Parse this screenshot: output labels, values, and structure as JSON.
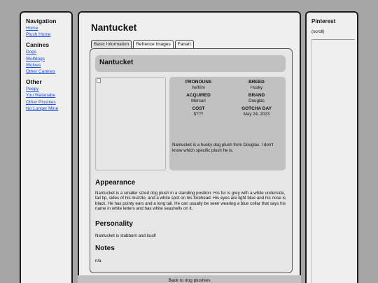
{
  "sidebar": {
    "navigation_heading": "Navigation",
    "navigation_links": [
      "Home",
      "Plush Home"
    ],
    "canines_heading": "Canines",
    "canines_links": [
      "Dogs",
      "Wolfdogs",
      "Wolves",
      "Other Canines"
    ],
    "other_heading": "Other",
    "other_links": [
      "Peepy",
      "You Watanabe",
      "Other Plushies",
      "No Longer Mine"
    ]
  },
  "page": {
    "title": "Nantucket",
    "tabs": [
      "Basic Information",
      "Refrence Images",
      "Fanart"
    ],
    "active_tab": "Basic Information",
    "name_bar": "Nantucket",
    "info": {
      "pronouns_label": "PRONOUNS",
      "pronouns": "he/him",
      "breed_label": "BREED",
      "breed": "Husky",
      "acquired_label": "ACQUIRED",
      "acquired": "Mercari",
      "brand_label": "BRAND",
      "brand": "Douglas",
      "cost_label": "COST",
      "cost": "$???",
      "gotcha_label": "GOTCHA DAY",
      "gotcha": "May 24, 2023",
      "description": "Nantucket is a husky dog plush from Douglas. I don't know which specific plush he is."
    },
    "appearance_heading": "Appearance",
    "appearance_text": "Nantucket is a smaller sized dog plush in a standing position. His fur is grey with a white underside, tail tip, sides of his muzzle, and a white spot on his forehead. His eyes are light blue and his nose is black. He has pointy ears and a long tail. He can usually be seen wearing a blue collar that says his name in white letters and has white seashells on it.",
    "personality_heading": "Personality",
    "personality_text": "Nantucket is stubborn and loud!",
    "notes_heading": "Notes",
    "notes_text": "n/a",
    "footer_link": "Back to dog plushies"
  },
  "right_panel": {
    "title": "Pinterest",
    "scroll_note": "(scroll)"
  }
}
